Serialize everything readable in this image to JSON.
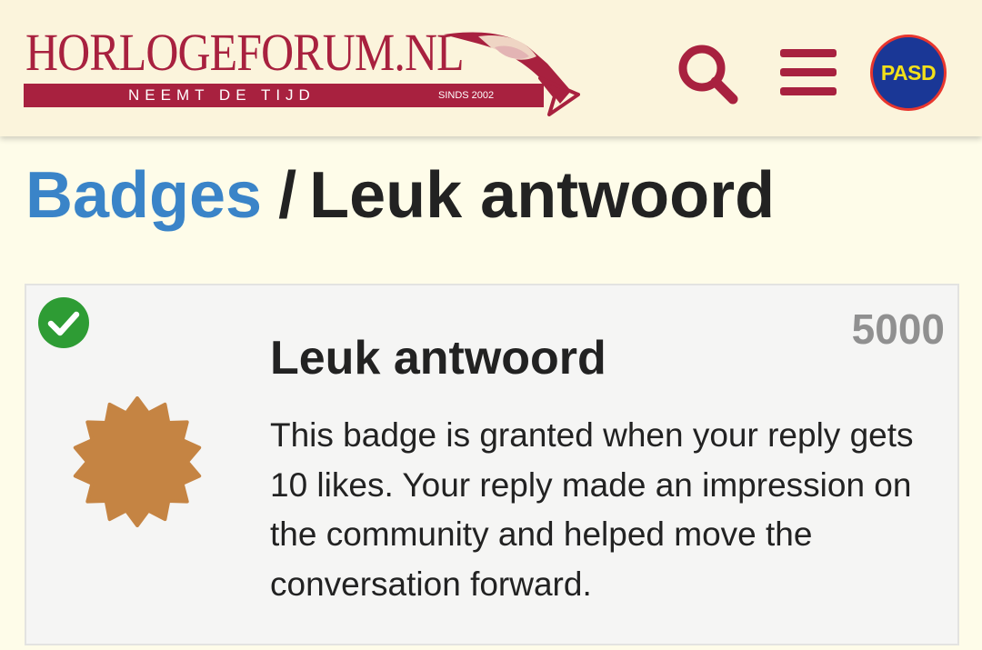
{
  "header": {
    "logo": {
      "title": "HORLOGEFORUM.NL",
      "tagline": "NEEMT DE TIJD",
      "since": "SINDS 2002"
    },
    "search_icon": "search-icon",
    "menu_icon": "hamburger-menu-icon",
    "avatar_text": "PASD"
  },
  "breadcrumb": {
    "parent": "Badges",
    "separator": "/",
    "current": "Leuk antwoord"
  },
  "badge": {
    "granted_icon": "check-circle-icon",
    "count": "5000",
    "title": "Leuk antwoord",
    "description": "This badge is granted when your reply gets 10 likes. Your reply made an impression on the community and helped move the conversation forward.",
    "icon": "starburst-bronze-badge-icon"
  },
  "colors": {
    "brand": "#a8213f",
    "link": "#3a84c8",
    "header_bg": "#fbf4dc",
    "page_bg": "#fefce9",
    "badge_bronze": "#c58443",
    "granted_green": "#2e9c34",
    "avatar_bg": "#1a3796",
    "avatar_text": "#f2e01a"
  }
}
